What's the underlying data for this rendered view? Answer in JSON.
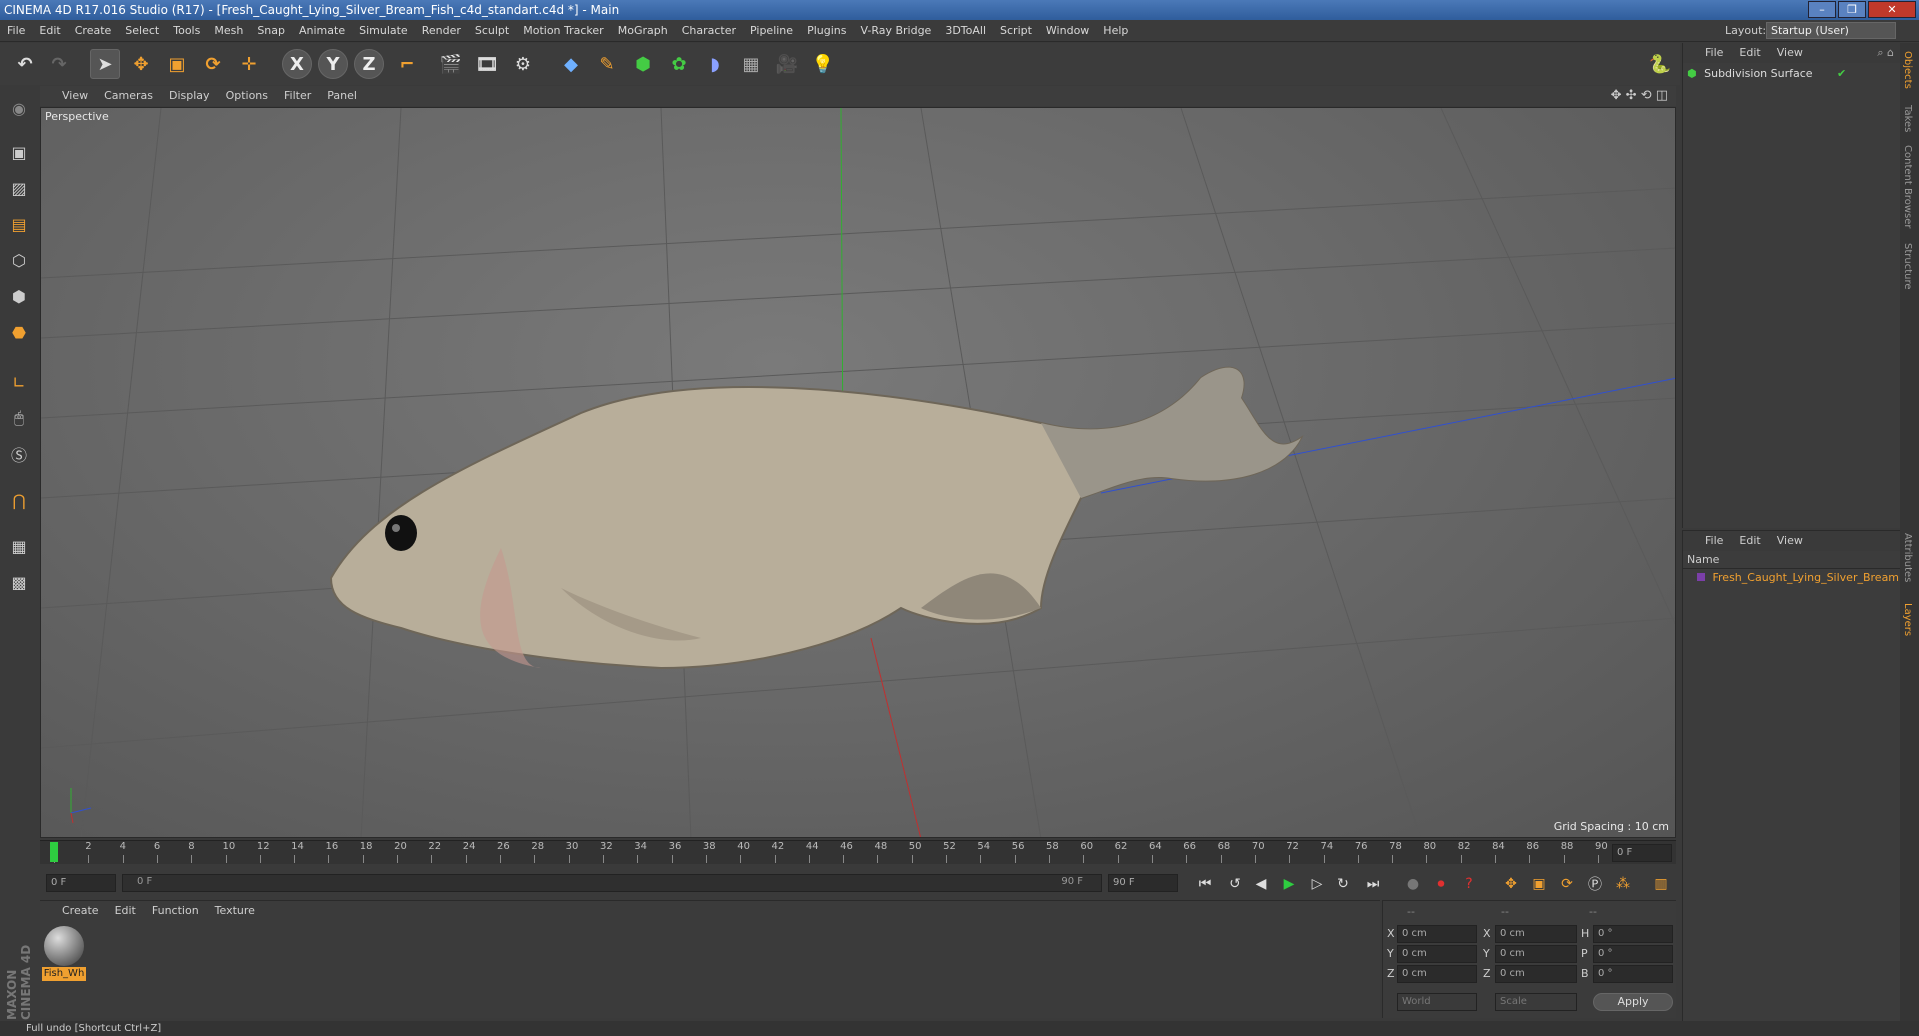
{
  "window": {
    "title": "CINEMA 4D R17.016 Studio (R17) - [Fresh_Caught_Lying_Silver_Bream_Fish_c4d_standart.c4d *] - Main",
    "controls": [
      "–",
      "❐",
      "✕"
    ]
  },
  "menubar": {
    "items": [
      "File",
      "Edit",
      "Create",
      "Select",
      "Tools",
      "Mesh",
      "Snap",
      "Animate",
      "Simulate",
      "Render",
      "Sculpt",
      "Motion Tracker",
      "MoGraph",
      "Character",
      "Pipeline",
      "Plugins",
      "V-Ray Bridge",
      "3DToAll",
      "Script",
      "Window",
      "Help"
    ],
    "layout_label": "Layout:",
    "layout_value": "Startup (User)"
  },
  "toolbar": {
    "axis_x": "X",
    "axis_y": "Y",
    "axis_z": "Z"
  },
  "viewport": {
    "menu": [
      "View",
      "Cameras",
      "Display",
      "Options",
      "Filter",
      "Panel"
    ],
    "camera_label": "Perspective",
    "grid_spacing": "Grid Spacing : 10 cm"
  },
  "timeline": {
    "ticks": [
      "0",
      "2",
      "4",
      "6",
      "8",
      "10",
      "12",
      "14",
      "16",
      "18",
      "20",
      "22",
      "24",
      "26",
      "28",
      "30",
      "32",
      "34",
      "36",
      "38",
      "40",
      "42",
      "44",
      "46",
      "48",
      "50",
      "52",
      "54",
      "56",
      "58",
      "60",
      "62",
      "64",
      "66",
      "68",
      "70",
      "72",
      "74",
      "76",
      "78",
      "80",
      "82",
      "84",
      "86",
      "88",
      "90"
    ],
    "current_frame": "0 F"
  },
  "transport": {
    "start_field": "0 F",
    "range_start": "0 F",
    "range_end": "90 F",
    "end_field": "90 F"
  },
  "materials": {
    "menu": [
      "Create",
      "Edit",
      "Function",
      "Texture"
    ],
    "items": [
      {
        "name": "Fish_Wh"
      }
    ]
  },
  "coords": {
    "header": [
      "--",
      "--",
      "--"
    ],
    "rows": [
      {
        "a": "X",
        "av": "0 cm",
        "b": "X",
        "bv": "0 cm",
        "c": "H",
        "cv": "0 °"
      },
      {
        "a": "Y",
        "av": "0 cm",
        "b": "Y",
        "bv": "0 cm",
        "c": "P",
        "cv": "0 °"
      },
      {
        "a": "Z",
        "av": "0 cm",
        "b": "Z",
        "bv": "0 cm",
        "c": "B",
        "cv": "0 °"
      }
    ],
    "mode1": "World",
    "mode2": "Scale",
    "apply": "Apply"
  },
  "object_manager": {
    "menu": [
      "File",
      "Edit",
      "View"
    ],
    "objects": [
      {
        "name": "Subdivision Surface"
      }
    ]
  },
  "layer_manager": {
    "menu": [
      "File",
      "Edit",
      "View"
    ],
    "column": "Name",
    "layers": [
      {
        "name": "Fresh_Caught_Lying_Silver_Bream"
      }
    ]
  },
  "side_tabs": [
    "Objects",
    "Takes",
    "Content Browser",
    "Structure",
    "Attributes",
    "Layers"
  ],
  "status": {
    "text": "Full undo [Shortcut Ctrl+Z]"
  },
  "brand": "MAXON CINEMA 4D",
  "colors": {
    "accent_orange": "#f0a030",
    "accent_blue": "#6fb0ff",
    "axis_x": "#c03030",
    "axis_y": "#30b030",
    "axis_z": "#3050d0"
  }
}
